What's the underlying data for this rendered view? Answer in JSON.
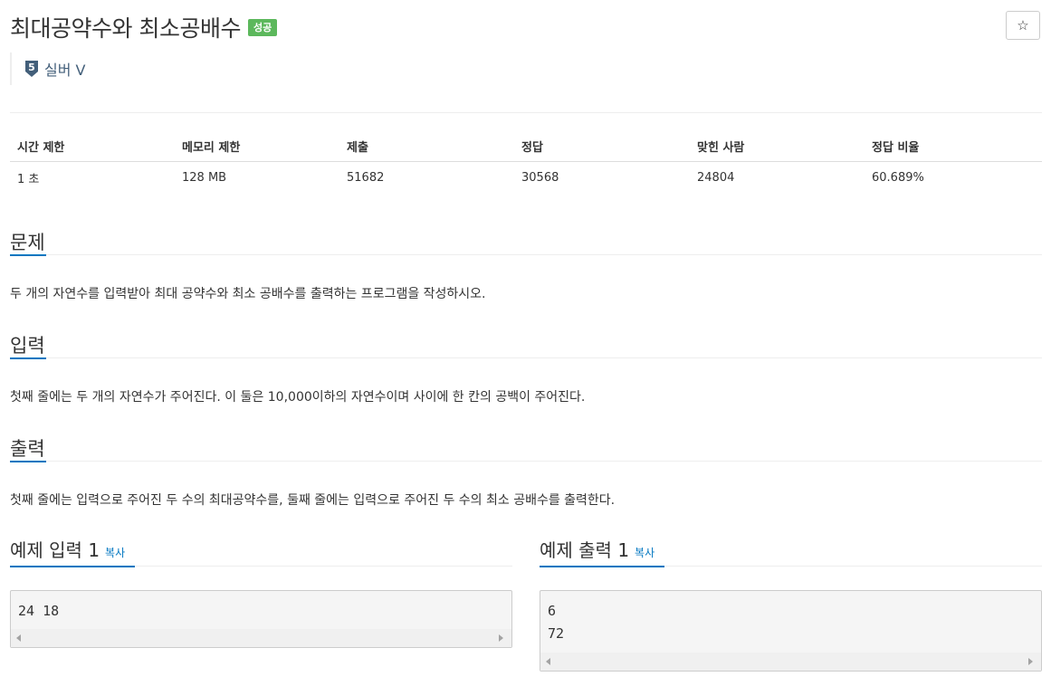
{
  "problem": {
    "title": "최대공약수와 최소공배수",
    "status_badge": "성공",
    "star_glyph": "☆",
    "tier": {
      "number": "5",
      "label": "실버 V",
      "color": "#435f7a"
    }
  },
  "info_table": {
    "headers": [
      "시간 제한",
      "메모리 제한",
      "제출",
      "정답",
      "맞힌 사람",
      "정답 비율"
    ],
    "values": [
      "1 초",
      "128 MB",
      "51682",
      "30568",
      "24804",
      "60.689%"
    ]
  },
  "sections": {
    "problem": {
      "title": "문제",
      "text": "두 개의 자연수를 입력받아 최대 공약수와 최소 공배수를 출력하는 프로그램을 작성하시오."
    },
    "input": {
      "title": "입력",
      "text": "첫째 줄에는 두 개의 자연수가 주어진다. 이 둘은 10,000이하의 자연수이며 사이에 한 칸의 공백이 주어진다."
    },
    "output": {
      "title": "출력",
      "text": "첫째 줄에는 입력으로 주어진 두 수의 최대공약수를, 둘째 줄에는 입력으로 주어진 두 수의 최소 공배수를 출력한다."
    }
  },
  "examples": {
    "input": {
      "title": "예제 입력 1",
      "copy_label": "복사",
      "content": "24 18"
    },
    "output": {
      "title": "예제 출력 1",
      "copy_label": "복사",
      "content": "6\n72"
    }
  },
  "colors": {
    "accent": "#0076c0",
    "success": "#5cb85c"
  }
}
